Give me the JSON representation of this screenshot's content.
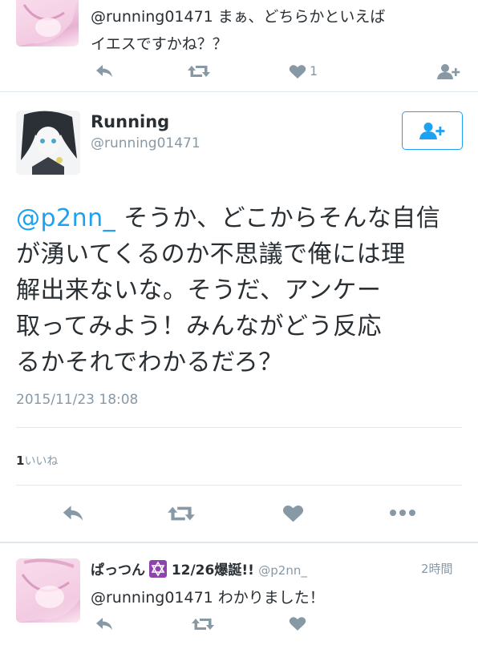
{
  "top_tweet": {
    "line1": "@running01471 まぁ、どちらかといえば",
    "line2": "イエスですかね？？",
    "like_count": "1"
  },
  "main_tweet": {
    "display_name": "Running",
    "handle": "@running01471",
    "mention": "@p2nn_",
    "line1_rest": " そうか、どこからそんな自信",
    "line2": "が湧いてくるのか不思議で俺には理",
    "line3": "解出来ないな。そうだ、アンケー",
    "line4": "取ってみよう！みんながどう反応",
    "line5": "るかそれでわかるだろ？",
    "timestamp": "2015/11/23 18:08",
    "likes_count": "1",
    "likes_label": "いいね"
  },
  "reply_tweet": {
    "display_name": "ぱっつん",
    "name_suffix": "12/26爆誕!!",
    "handle": "@p2nn_",
    "time": "2時間",
    "text": "@running01471 わかりました！"
  },
  "colors": {
    "accent": "#1da1f2",
    "icon_gray": "#8899a6",
    "divider": "#e1e8ed"
  },
  "icons": [
    "reply-icon",
    "retweet-icon",
    "heart-icon",
    "follow-icon",
    "more-icon",
    "star-of-david-icon"
  ]
}
